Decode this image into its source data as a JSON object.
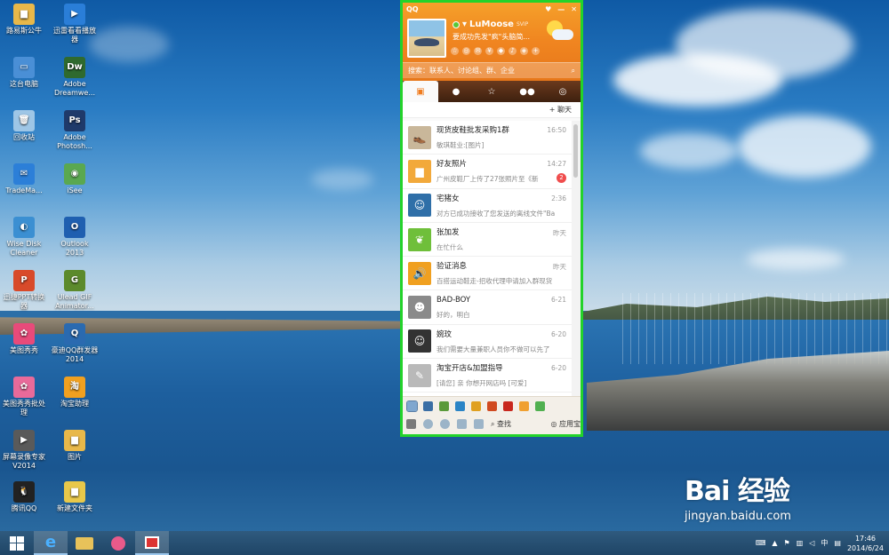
{
  "desktop": {
    "icons": [
      {
        "label": "路易斯公牛",
        "icon": "folder-icon",
        "color": "#e8b84a",
        "glyph": "▆"
      },
      {
        "label": "迅雷看看播放器",
        "icon": "xunlei-icon",
        "color": "#2a7ed8",
        "glyph": "▶"
      },
      {
        "label": "这台电脑",
        "icon": "computer-icon",
        "color": "#4a8fd6",
        "glyph": "▭"
      },
      {
        "label": "Adobe Dreamwe...",
        "icon": "dreamweaver-icon",
        "color": "#2f6a2f",
        "glyph": "Dw"
      },
      {
        "label": "回收站",
        "icon": "recycle-bin-icon",
        "color": "#9ec6e6",
        "glyph": "🗑"
      },
      {
        "label": "Adobe Photosh...",
        "icon": "photoshop-icon",
        "color": "#1f3a6a",
        "glyph": "Ps"
      },
      {
        "label": "TradeMa...",
        "icon": "trademanager-icon",
        "color": "#2c7fd8",
        "glyph": "✉"
      },
      {
        "label": "iSee",
        "icon": "isee-icon",
        "color": "#5aa850",
        "glyph": "◉"
      },
      {
        "label": "Wise Disk Cleaner",
        "icon": "disk-cleaner-icon",
        "color": "#3b8fd2",
        "glyph": "◐"
      },
      {
        "label": "Outlook 2013",
        "icon": "outlook-icon",
        "color": "#1f5fb0",
        "glyph": "O"
      },
      {
        "label": "迅捷PPT转换器",
        "icon": "ppt-converter-icon",
        "color": "#d84a2a",
        "glyph": "P"
      },
      {
        "label": "Ulead GIF Animator...",
        "icon": "gif-animator-icon",
        "color": "#5c8a2c",
        "glyph": "G"
      },
      {
        "label": "美图秀秀",
        "icon": "meitu-icon",
        "color": "#e84a7a",
        "glyph": "✿"
      },
      {
        "label": "豪迪QQ群发器 2014",
        "icon": "qq-sender-icon",
        "color": "#2a6ab0",
        "glyph": "Q"
      },
      {
        "label": "美图秀秀批处理",
        "icon": "meitu-batch-icon",
        "color": "#e86a9a",
        "glyph": "✿"
      },
      {
        "label": "淘宝助理",
        "icon": "taobao-assistant-icon",
        "color": "#f0a020",
        "glyph": "淘"
      },
      {
        "label": "屏幕录像专家V2014",
        "icon": "screen-recorder-icon",
        "color": "#5a5a5a",
        "glyph": "▶"
      },
      {
        "label": "图片",
        "icon": "pictures-icon",
        "color": "#e8b84a",
        "glyph": "▆"
      },
      {
        "label": "腾讯QQ",
        "icon": "qq-icon",
        "color": "#222",
        "glyph": "🐧"
      },
      {
        "label": "新建文件夹",
        "icon": "new-folder-icon",
        "color": "#e8c84a",
        "glyph": "▆"
      }
    ]
  },
  "qq": {
    "title": "QQ",
    "username": "LuMoose",
    "level": "SVIP",
    "signature": "要成功先发\"疯\"头脑简...",
    "search_placeholder": "搜索：联系人、讨论组、群、企业",
    "tabs": [
      "会话",
      "联系人",
      "收藏",
      "群",
      "空间"
    ],
    "chat_button": "+ 聊天",
    "conversations": [
      {
        "name": "现货皮鞋批发采购1群",
        "message": "敏琪鞋业:[图片]",
        "time": "16:50",
        "avatar_color": "#c9b79a",
        "glyph": "👞",
        "badge": ""
      },
      {
        "name": "好友照片",
        "message": "广州皮鞋厂上传了27张照片至《新",
        "time": "14:27",
        "avatar_color": "#f2a93b",
        "glyph": "▆",
        "badge": "2"
      },
      {
        "name": "宅猪女",
        "message": "对方已成功接收了您发送的离线文件\"Ba",
        "time": "2:36",
        "avatar_color": "#2f6fa8",
        "glyph": "☺",
        "badge": ""
      },
      {
        "name": "张加发",
        "message": "在忙什么",
        "time": "昨天",
        "avatar_color": "#6fbf3a",
        "glyph": "❦",
        "badge": ""
      },
      {
        "name": "验证消息",
        "message": "百搭运动鞋走-招收代理申请加入群现货",
        "time": "昨天",
        "avatar_color": "#f0a020",
        "glyph": "🔊",
        "badge": ""
      },
      {
        "name": "BAD-BOY",
        "message": "好的，明白",
        "time": "6-21",
        "avatar_color": "#8a8a8a",
        "glyph": "☻",
        "badge": ""
      },
      {
        "name": "婉玟",
        "message": "我们需要大量兼职人员你不做可以先了",
        "time": "6-20",
        "avatar_color": "#333333",
        "glyph": "☺",
        "badge": ""
      },
      {
        "name": "淘宝开店&加盟指导",
        "message": "[请您] 亲 你想开网店吗 [可爱]",
        "time": "6-20",
        "avatar_color": "#b9b9b9",
        "glyph": "✎",
        "badge": ""
      }
    ],
    "bottom_search": "查找",
    "bottom_apps": "应用宝"
  },
  "watermark": {
    "brand": "Bai  经验",
    "url": "jingyan.baidu.com"
  },
  "taskbar": {
    "time": "17:46",
    "date": "2014/6/24",
    "ime": "中"
  }
}
